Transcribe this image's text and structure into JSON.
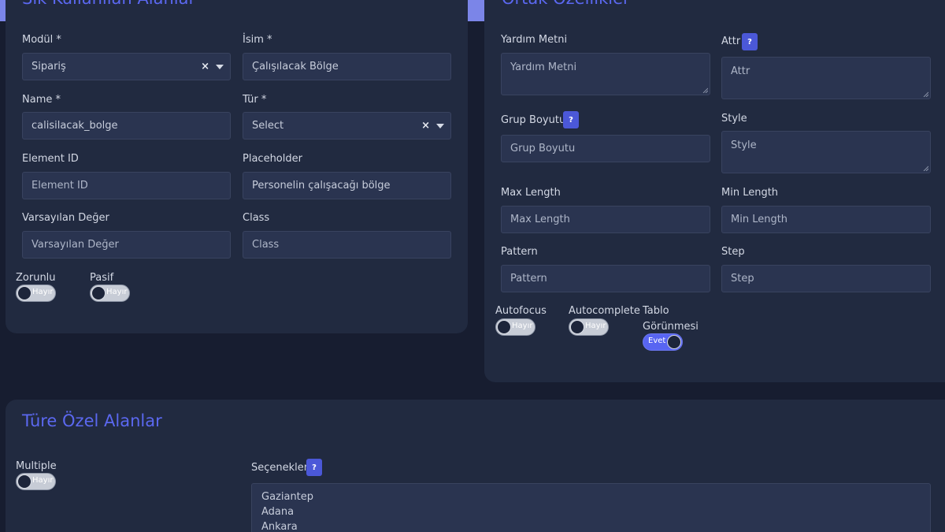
{
  "panel_left": {
    "title": "Sık Kullanılan Alanlar",
    "fields": {
      "modul": {
        "label": "Modül *",
        "value": "Sipariş"
      },
      "isim": {
        "label": "İsim *",
        "value": "Çalışılacak Bölge"
      },
      "name": {
        "label": "Name *",
        "value": "calisilacak_bolge"
      },
      "tur": {
        "label": "Tür *",
        "value": "Select"
      },
      "element_id": {
        "label": "Element ID",
        "placeholder": "Element ID"
      },
      "placeholder": {
        "label": "Placeholder",
        "value": "Personelin çalışacağı bölge"
      },
      "varsayilan": {
        "label": "Varsayılan Değer",
        "placeholder": "Varsayılan Değer"
      },
      "class": {
        "label": "Class",
        "placeholder": "Class"
      }
    },
    "toggles": {
      "zorunlu": {
        "label": "Zorunlu",
        "state": "Hayır"
      },
      "pasif": {
        "label": "Pasif",
        "state": "Hayır"
      }
    }
  },
  "panel_right": {
    "title": "Ortak Özellikler",
    "fields": {
      "yardim": {
        "label": "Yardım Metni",
        "placeholder": "Yardım Metni"
      },
      "attr": {
        "label": "Attr",
        "placeholder": "Attr"
      },
      "grup": {
        "label": "Grup Boyutu",
        "placeholder": "Grup Boyutu"
      },
      "style": {
        "label": "Style",
        "placeholder": "Style"
      },
      "max_length": {
        "label": "Max Length",
        "placeholder": "Max Length"
      },
      "min_length": {
        "label": "Min Length",
        "placeholder": "Min Length"
      },
      "pattern": {
        "label": "Pattern",
        "placeholder": "Pattern"
      },
      "step": {
        "label": "Step",
        "placeholder": "Step"
      }
    },
    "toggles": {
      "autofocus": {
        "label": "Autofocus",
        "state": "Hayır"
      },
      "autocomplete": {
        "label": "Autocomplete",
        "state": "Hayır"
      },
      "tablo": {
        "label_line1": "Tablo",
        "label_line2": "Görünmesi",
        "state": "Evet"
      }
    }
  },
  "panel_bottom": {
    "title": "Türe Özel Alanlar",
    "multiple": {
      "label": "Multiple",
      "state": "Hayır"
    },
    "secenekler": {
      "label": "Seçenekler",
      "options": [
        "Gaziantep",
        "Adana",
        "Ankara"
      ]
    }
  },
  "help_glyph": "?",
  "clear_glyph": "×",
  "colors": {
    "background": "#171d30",
    "panel": "#212a40",
    "accent": "#5b68f0",
    "toggle_on": "#5865f2"
  },
  "icons": [
    "clear-icon",
    "chevron-down-icon",
    "question-icon",
    "resize-grip-icon"
  ]
}
